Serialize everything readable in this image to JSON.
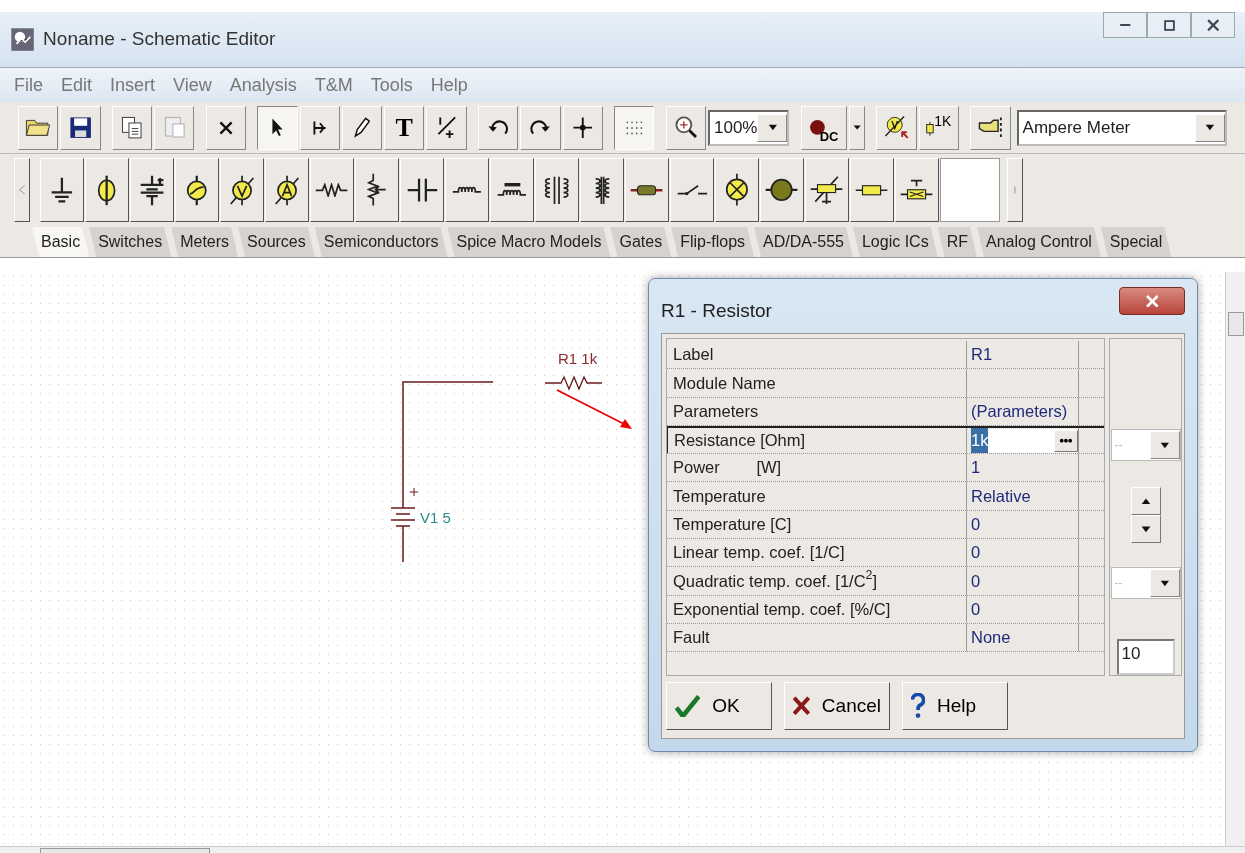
{
  "window": {
    "title": "Noname - Schematic Editor"
  },
  "menu": [
    {
      "label": "File"
    },
    {
      "label": "Edit"
    },
    {
      "label": "Insert"
    },
    {
      "label": "View"
    },
    {
      "label": "Analysis"
    },
    {
      "label": "T&M"
    },
    {
      "label": "Tools"
    },
    {
      "label": "Help"
    }
  ],
  "toolbar": {
    "tools": [
      {
        "kind": "open",
        "pressed": false
      },
      {
        "kind": "save",
        "pressed": false
      },
      {
        "kind": "copy",
        "pressed": false
      },
      {
        "kind": "paste",
        "pressed": false
      },
      {
        "kind": "delete",
        "pressed": false
      },
      {
        "kind": "select",
        "pressed": true
      },
      {
        "kind": "wire",
        "pressed": false
      },
      {
        "kind": "pen",
        "pressed": false
      },
      {
        "kind": "text",
        "label": "T",
        "pressed": false
      },
      {
        "kind": "angle",
        "pressed": false
      },
      {
        "kind": "undo",
        "pressed": false
      },
      {
        "kind": "redo",
        "pressed": false
      },
      {
        "kind": "junction",
        "pressed": false
      },
      {
        "kind": "grid",
        "pressed": true
      },
      {
        "kind": "zoom",
        "pressed": false
      }
    ],
    "zoom": "100%",
    "source_label": "DC",
    "meter_label": "1K",
    "component": "Ampere Meter"
  },
  "palette": [
    {
      "kind": "ground"
    },
    {
      "kind": "current-source"
    },
    {
      "kind": "battery"
    },
    {
      "kind": "ac-source"
    },
    {
      "kind": "voltmeter"
    },
    {
      "kind": "ammeter"
    },
    {
      "kind": "resistor"
    },
    {
      "kind": "potentiometer"
    },
    {
      "kind": "capacitor"
    },
    {
      "kind": "inductor"
    },
    {
      "kind": "core-inductor"
    },
    {
      "kind": "coupled-inductors"
    },
    {
      "kind": "transformer"
    },
    {
      "kind": "cable"
    },
    {
      "kind": "switch"
    },
    {
      "kind": "lamp"
    },
    {
      "kind": "motor"
    },
    {
      "kind": "thermistor"
    },
    {
      "kind": "fuse"
    },
    {
      "kind": "zener"
    },
    {
      "kind": "empty"
    }
  ],
  "tabs": [
    {
      "label": "Basic",
      "selected": true
    },
    {
      "label": "Switches",
      "selected": false
    },
    {
      "label": "Meters",
      "selected": false
    },
    {
      "label": "Sources",
      "selected": false
    },
    {
      "label": "Semiconductors",
      "selected": false
    },
    {
      "label": "Spice Macro Models",
      "selected": false
    },
    {
      "label": "Gates",
      "selected": false
    },
    {
      "label": "Flip-flops",
      "selected": false
    },
    {
      "label": "AD/DA-555",
      "selected": false
    },
    {
      "label": "Logic ICs",
      "selected": false
    },
    {
      "label": "RF",
      "selected": false
    },
    {
      "label": "Analog Control",
      "selected": false
    },
    {
      "label": "Special",
      "selected": false
    }
  ],
  "schematic": {
    "resistor_label": "R1 1k",
    "battery_label": "V1 5"
  },
  "dialog": {
    "title": "R1 - Resistor",
    "rows": [
      {
        "label": "Label",
        "value": "R1",
        "selected": false
      },
      {
        "label": "Module Name",
        "selected": false
      },
      {
        "label": "Parameters",
        "value": "(Parameters)",
        "selected": false
      },
      {
        "label": "Resistance [Ohm]",
        "value": "1k",
        "selected": true
      },
      {
        "label": "Power        [W]",
        "value": "1",
        "selected": false
      },
      {
        "label": "Temperature",
        "value": "Relative",
        "selected": false
      },
      {
        "label": "Temperature [C]",
        "value": "0",
        "selected": false
      },
      {
        "label": "Linear temp. coef. [1/C]",
        "value": "0",
        "selected": false
      },
      {
        "label": "Quadratic temp. coef. [1/C$^{2}$]",
        "value": "0",
        "selected": false
      },
      {
        "label": "Exponential temp. coef. [%/C]",
        "value": "0",
        "selected": false
      },
      {
        "label": "Fault",
        "value": "None",
        "selected": false
      }
    ],
    "unit_dropdown_1": "--",
    "unit_dropdown_2": "--",
    "step_field": "10",
    "buttons": [
      {
        "kind": "ok",
        "label": "OK"
      },
      {
        "kind": "cancel",
        "label": "Cancel"
      },
      {
        "kind": "help",
        "label": "Help"
      }
    ]
  }
}
